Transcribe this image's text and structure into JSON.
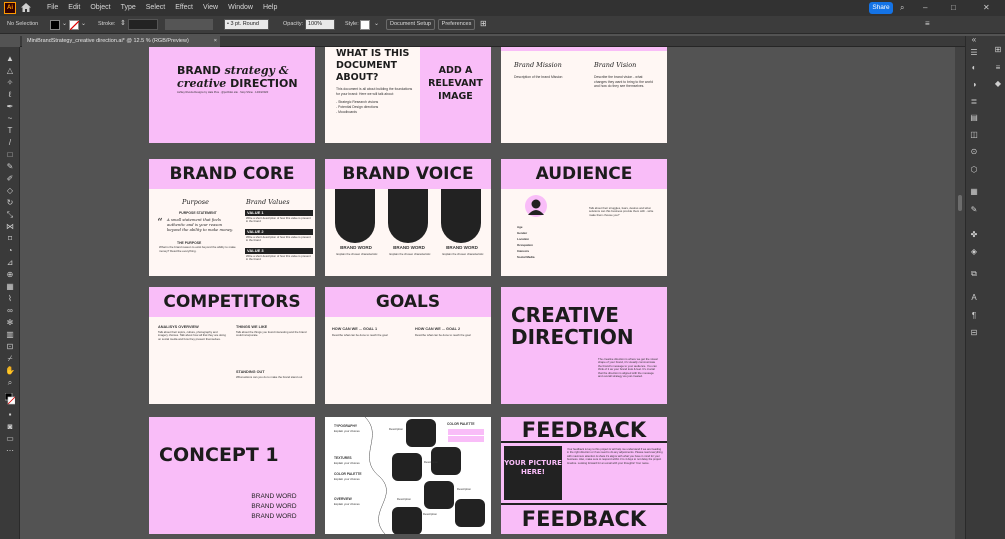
{
  "menubar": {
    "app_icon": "Ai",
    "menus": [
      "File",
      "Edit",
      "Object",
      "Type",
      "Select",
      "Effect",
      "View",
      "Window",
      "Help"
    ],
    "share_label": "Share"
  },
  "control": {
    "selection": "No Selection",
    "stroke_label": "Stroke:",
    "brush": "3 pt. Round",
    "opacity_label": "Opacity:",
    "opacity_value": "100%",
    "style_label": "Style:",
    "doc_setup": "Document Setup",
    "preferences": "Preferences"
  },
  "document": {
    "tab_title": "MiniBrandStrategy_creative direction.ai* @ 12.5 % (RGB/Preview)",
    "close": "×"
  },
  "colors": {
    "pink": "#f9bdf8",
    "cream": "#fff7f4",
    "dark": "#222222",
    "accent": "#1473e6"
  },
  "artboards": {
    "cover": {
      "line1": "BRAND",
      "line1b": "strategy &",
      "line2": "creative",
      "line2b": "DIRECTION",
      "byline": "Ashley Riveria Designs by Hale Pica · @portfolio.site · Stop Shine · 14/03/2020"
    },
    "about": {
      "title": "WHAT IS THIS DOCUMENT ABOUT?",
      "body": "This document is all about building the foundations for your brand: Here we will talk about:",
      "list": [
        "- Strategic Research visions",
        "- Potential Design directions",
        "- Moodboards"
      ],
      "side": "ADD A RELEVANT IMAGE"
    },
    "mission": {
      "mission_title": "Brand Mission",
      "vision_title": "Brand Vision",
      "mission_text": "Description of the brand Mission",
      "vision_text": "Describe the brand vision - what changes they want to bring to the world and how do they see themselves."
    },
    "core": {
      "title": "BRAND CORE",
      "purpose": "Purpose",
      "purpose_stmt": "PURPOSE STATEMENT",
      "quote": "A small statement that feels authentic and is your reason beyond the ability to make money.",
      "purpose_head": "THE PURPOSE",
      "purpose_body": "What is the brand reason to exist beyond the ability to make money? Describe everything.",
      "values_title": "Brand Values",
      "values": [
        "VALUE 1",
        "VALUE 2",
        "VALUE 3"
      ],
      "value_desc": "Write a short description of how this value is present in the brand"
    },
    "voice": {
      "title": "BRAND VOICE",
      "word": "BRAND WORD",
      "desc": "Explain the chosen characteristic"
    },
    "audience": {
      "title": "AUDIENCE",
      "text": "Talk about their struggles, fears, desires and what solutions can this business provide them with - write make them choose you?",
      "fields": [
        "Age",
        "Gender",
        "Location",
        "Occupation",
        "Interests",
        "Social Media"
      ]
    },
    "competitors": {
      "title": "COMPETITORS",
      "analysis": "ANALISYS OVERVIEW",
      "analysis_text": "Talk about their topics, culture, photography and imagery choices. Talk about how all that they are doing on social media and how they present themselves.",
      "like": "THINGS WE LIKE",
      "like_text": "Talk about the things you found interesting and the brand could incorporate.",
      "standing": "STANDING OUT",
      "standing_text": "What actions can you do to make the brand stand out"
    },
    "goals": {
      "title": "GOALS",
      "g1": "HOW CAN WE ... GOAL 1",
      "g2": "HOW CAN WE ... GOAL 2",
      "desc": "Describe what can be done to reach the goal"
    },
    "creative": {
      "title1": "CREATIVE",
      "title2": "DIRECTION",
      "text": "The creative direction is where we get the visual shape of your brand, it's visually communicate the brand's message to your audience. You can think of it as your brand look & feel. It's crucial that the direction is aligned with the message and overall strategy we just created."
    },
    "concept": {
      "title": "CONCEPT 1",
      "words": [
        "BRAND WORD",
        "BRAND WORD",
        "BRAND WORD"
      ]
    },
    "moodboard": {
      "typography": "TYPOGRAPHY",
      "textures": "TEXTURES",
      "color_palette": "COLOR PALETTE",
      "overview": "OVERVIEW",
      "explain": "Explain your choices",
      "description": "Description"
    },
    "feedback": {
      "title": "FEEDBACK",
      "picture": "YOUR PICTURE HERE!",
      "text": "Your feedback is key to this project & will help me understand if we are heading in the right direction or if we need to do any adjustments. Please read everything with maximum attention & share it's aligns with what you have in mind for your business. Also, make sure to respond within 3 to 4 days to not delay the project timeline. Looking forward for an email with your thoughts! Your name."
    }
  }
}
